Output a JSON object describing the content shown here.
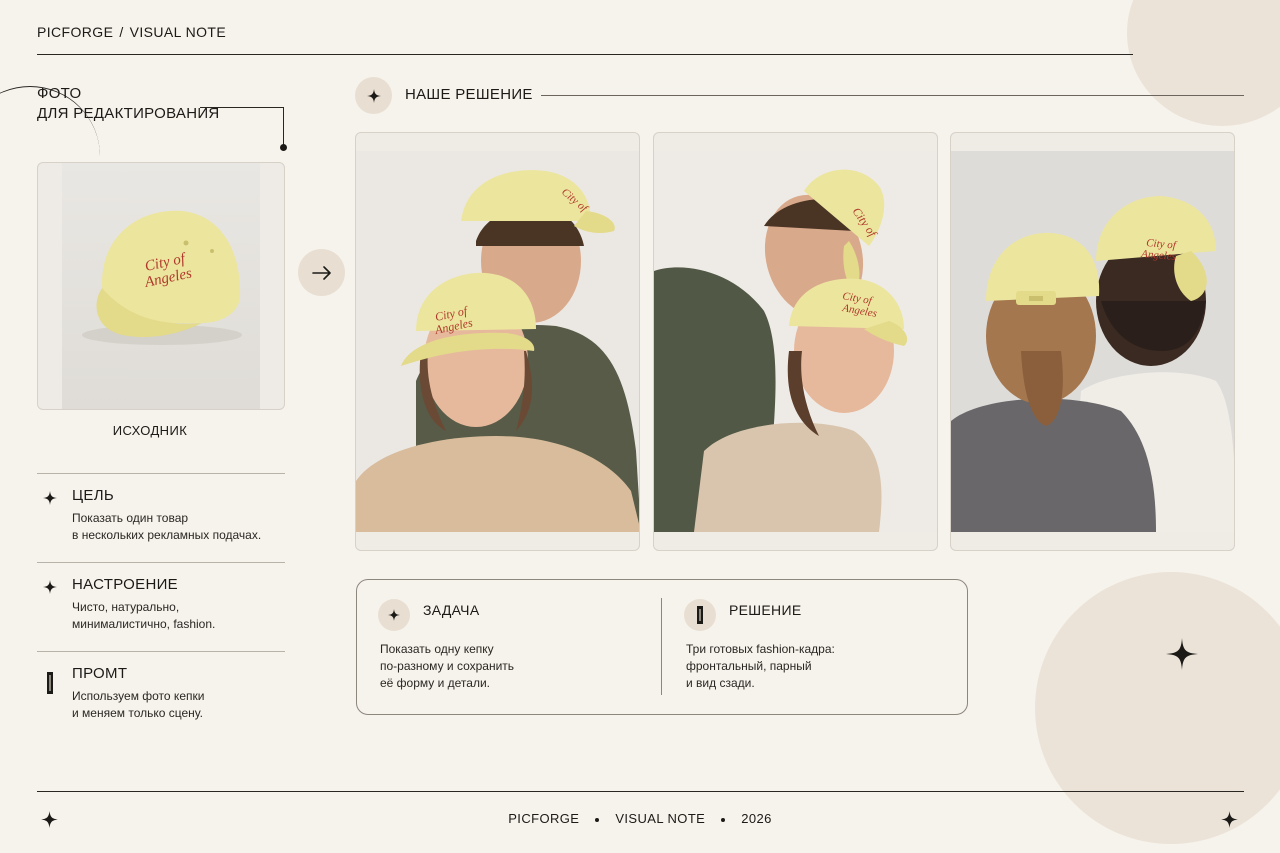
{
  "header": {
    "brand": "PICFORGE",
    "separator": "/",
    "section": "VISUAL NOTE"
  },
  "source": {
    "title_line1": "ФОТО",
    "title_line2": "ДЛЯ РЕДАКТИРОВАНИЯ",
    "label": "ИСХОДНИК",
    "cap_text_line1": "City of",
    "cap_text_line2": "Angeles"
  },
  "info_blocks": [
    {
      "icon": "sparkle-icon",
      "title": "ЦЕЛЬ",
      "line1": "Показать один товар",
      "line2": "в нескольких рекламных подачах."
    },
    {
      "icon": "sparkle-icon",
      "title": "НАСТРОЕНИЕ",
      "line1": "Чисто, натурально,",
      "line2": "минималистично, fashion."
    },
    {
      "icon": "text-cursor-icon",
      "title": "ПРОМТ",
      "line1": "Используем фото кепки",
      "line2": "и меняем только сцену."
    }
  ],
  "solution": {
    "title": "НАШЕ РЕШЕНИЕ",
    "photos": [
      {
        "name": "couple-front-view",
        "cap_text": "City of Angeles"
      },
      {
        "name": "couple-paired-view",
        "cap_text": "City of Angeles"
      },
      {
        "name": "couple-back-view",
        "cap_text": "City of Angeles"
      }
    ]
  },
  "task": {
    "title": "ЗАДАЧА",
    "line1": "Показать одну кепку",
    "line2": "по-разному и сохранить",
    "line3": "её форму и детали."
  },
  "result": {
    "title": "РЕШЕНИЕ",
    "line1": "Три готовых fashion-кадра:",
    "line2": "фронтальный, парный",
    "line3": "и вид сзади."
  },
  "footer": {
    "brand": "PICFORGE",
    "section": "VISUAL NOTE",
    "year": "2026"
  },
  "colors": {
    "background": "#f6f2ec",
    "accent_circle": "#ebe3d8",
    "cap_yellow": "#ebe39a",
    "embroidery_red": "#b0392b"
  }
}
